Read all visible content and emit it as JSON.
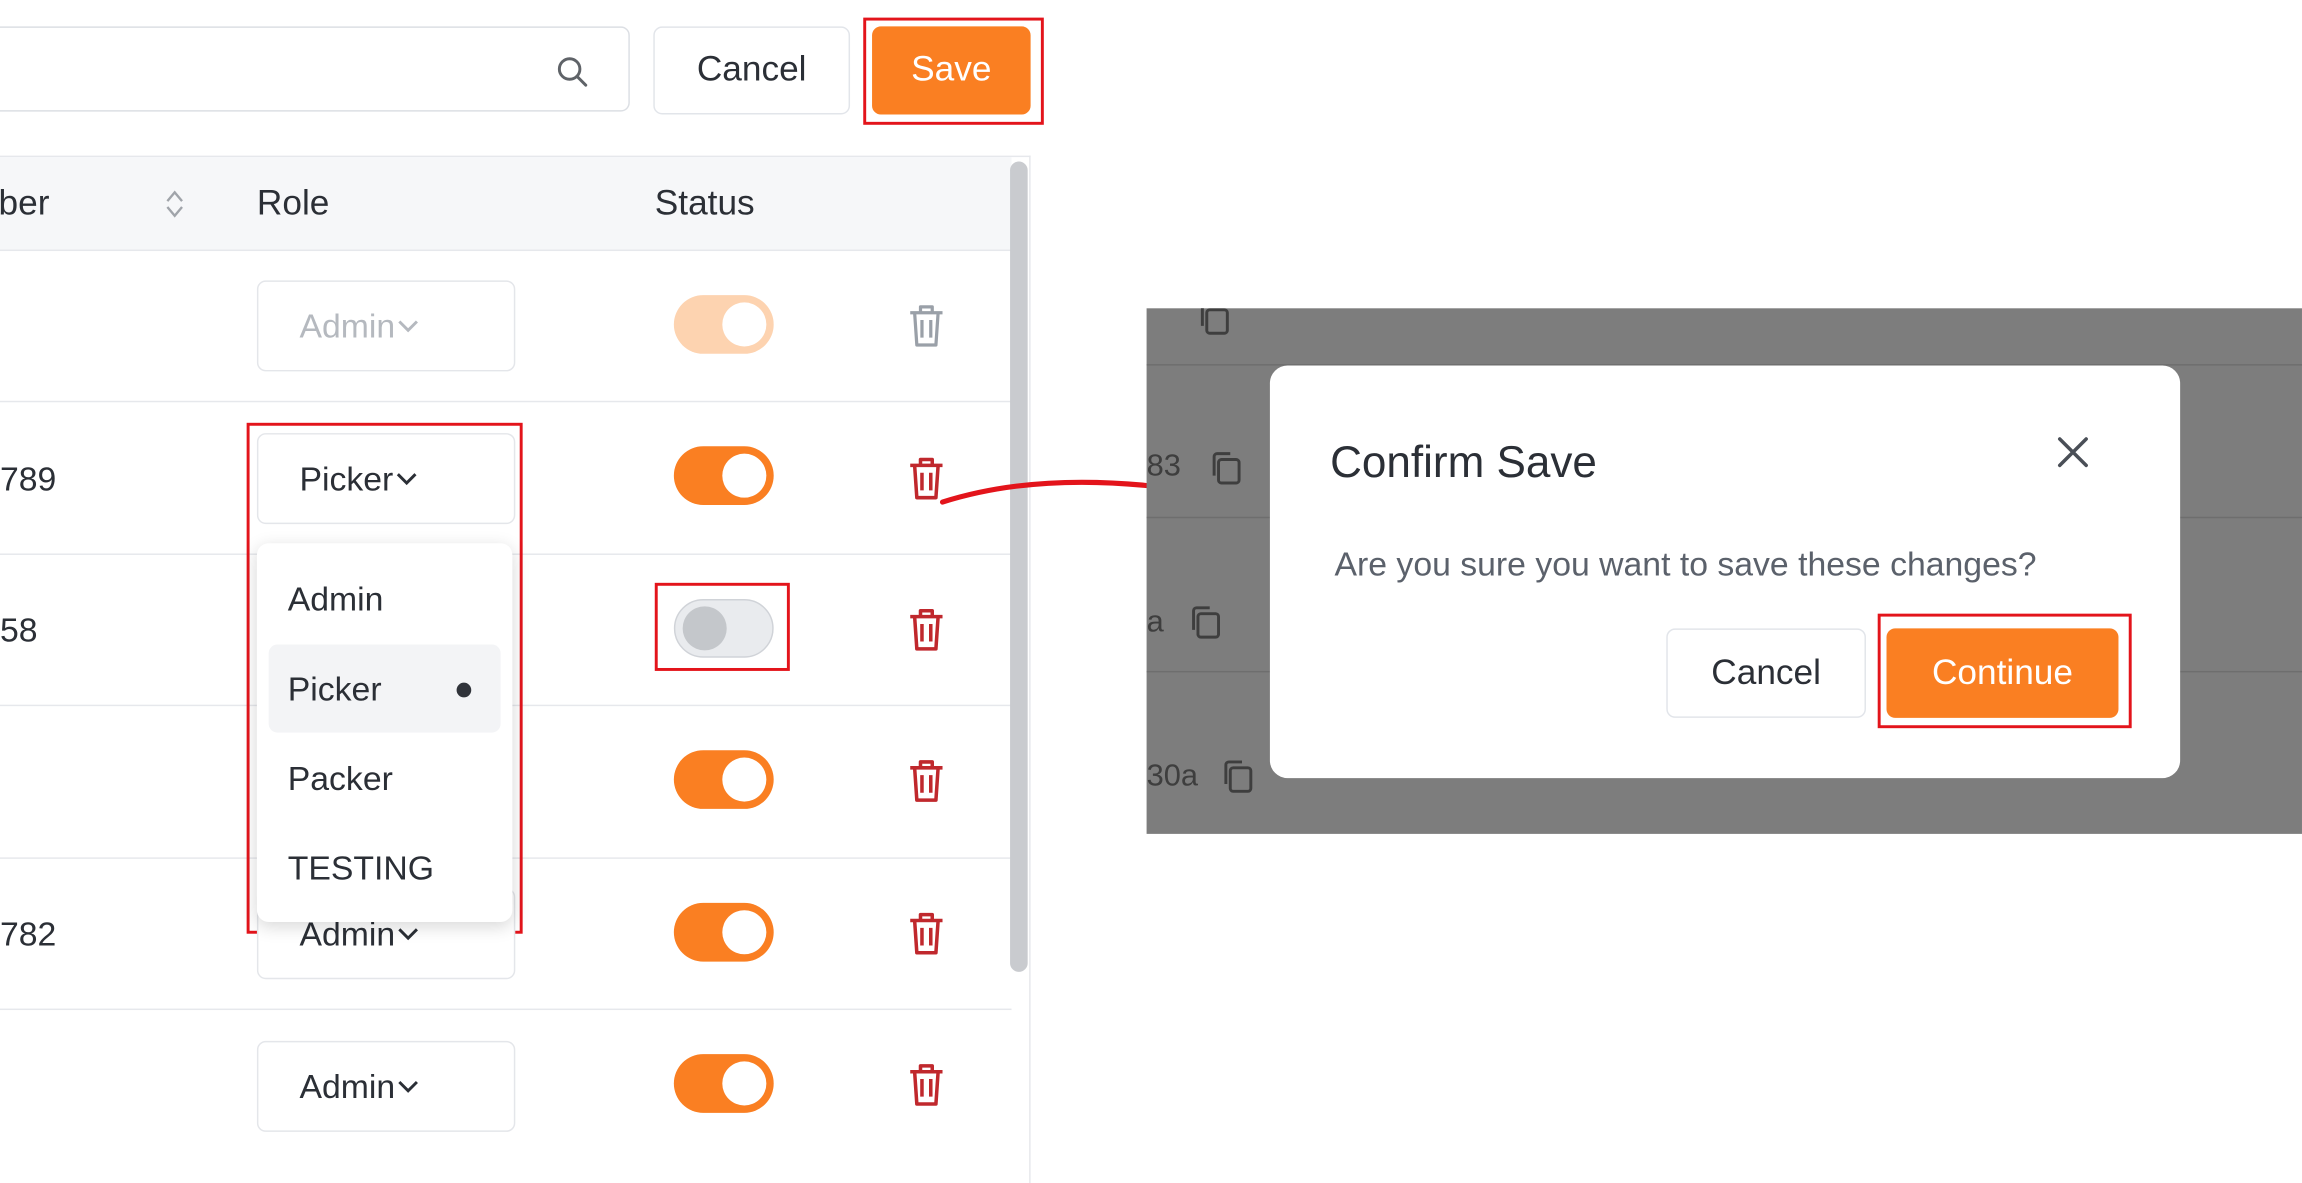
{
  "toolbar": {
    "cancel_label": "Cancel",
    "save_label": "Save",
    "search_icon": "search-icon"
  },
  "table": {
    "headers": {
      "number_partial": "ber",
      "role": "Role",
      "status": "Status"
    },
    "rows": [
      {
        "number": "",
        "role": "Admin",
        "status_on": true,
        "disabled": true
      },
      {
        "number": "789",
        "role": "Picker",
        "status_on": true
      },
      {
        "number": "58",
        "role": "",
        "status_on": false
      },
      {
        "number": "",
        "role": "",
        "status_on": true
      },
      {
        "number": "782",
        "role": "Admin",
        "status_on": true
      },
      {
        "number": "",
        "role": "Admin",
        "status_on": true
      }
    ]
  },
  "dropdown": {
    "options": [
      "Admin",
      "Picker",
      "Packer",
      "TESTING"
    ],
    "selected": "Picker"
  },
  "background_rows": [
    "83",
    "a",
    "30a"
  ],
  "modal": {
    "title": "Confirm Save",
    "message": "Are you sure you want to save these changes?",
    "cancel_label": "Cancel",
    "continue_label": "Continue"
  },
  "colors": {
    "accent": "#fa7f22",
    "accent_disabled": "#fdd3b0",
    "danger": "#c0282d",
    "highlight": "#e3141b"
  }
}
